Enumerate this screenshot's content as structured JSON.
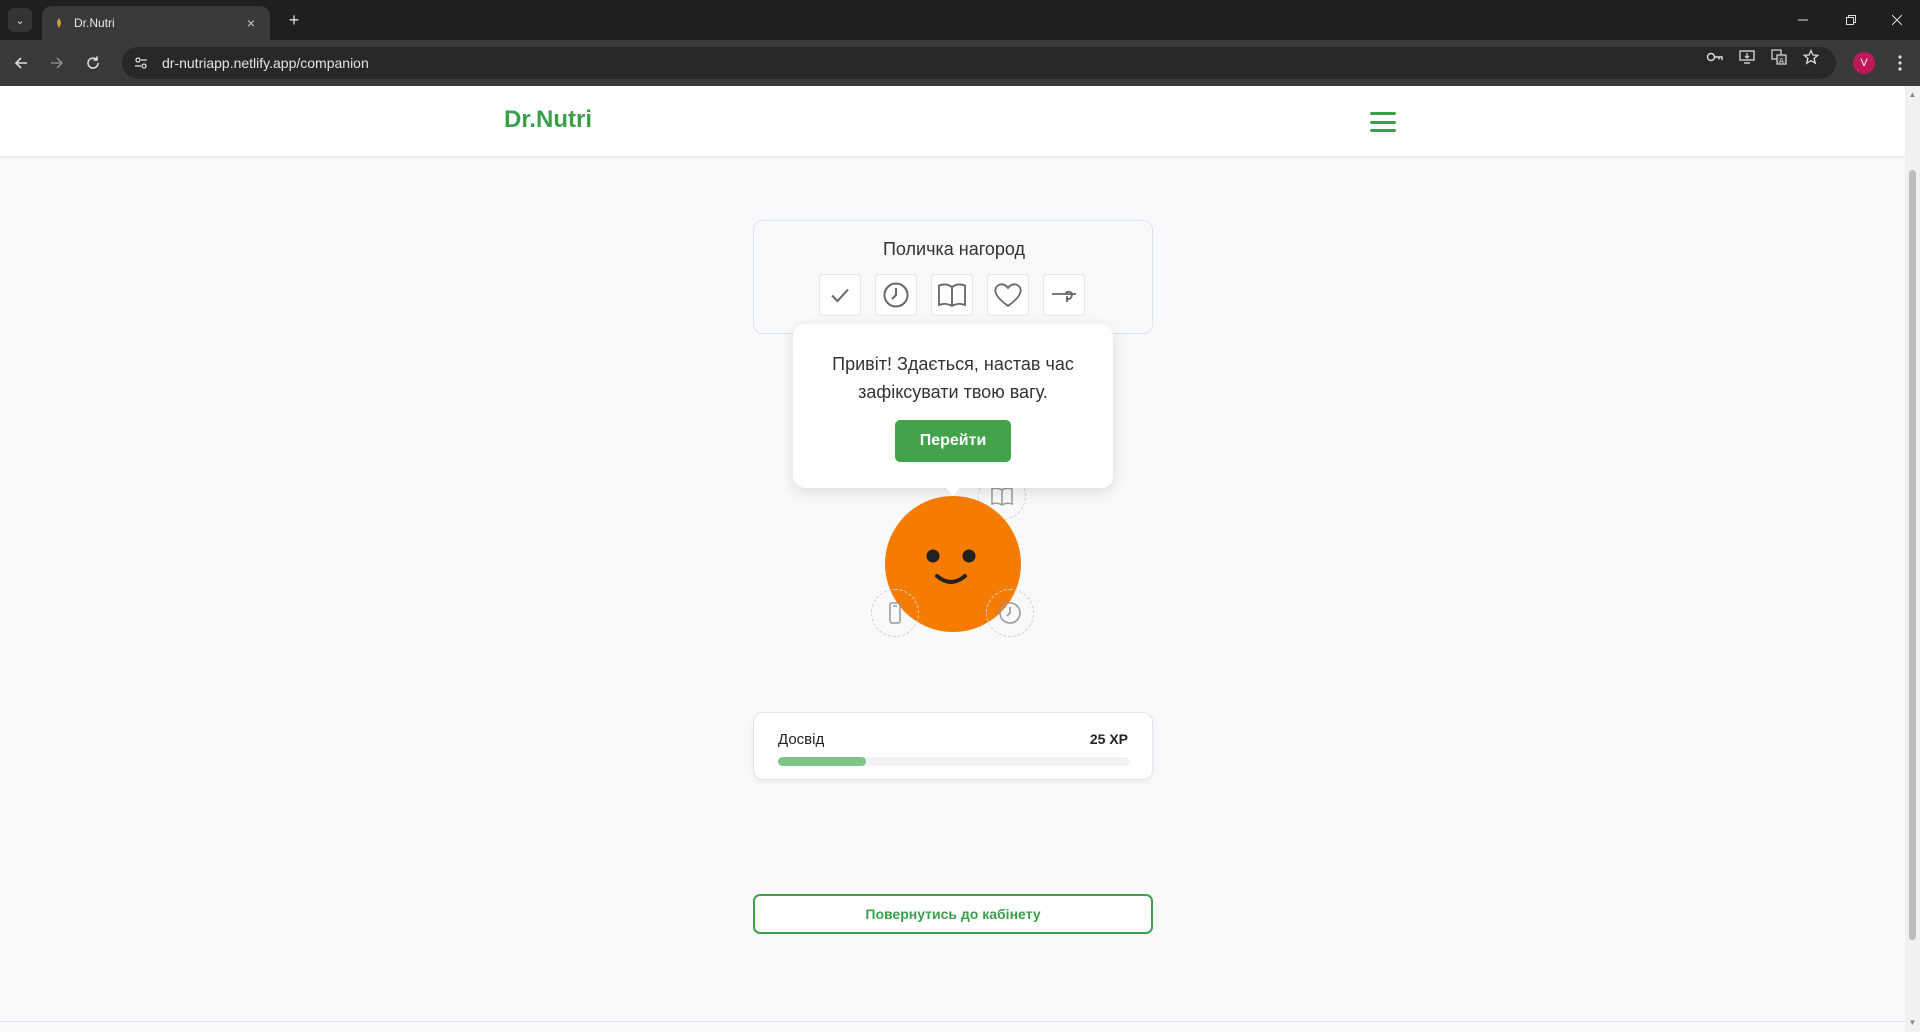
{
  "browser": {
    "tab_title": "Dr.Nutri",
    "tab_close": "×",
    "new_tab": "+",
    "url": "dr-nutriapp.netlify.app/companion",
    "profile_initial": "V"
  },
  "header": {
    "brand": "Dr.Nutri",
    "brand_color": "#3aa14a"
  },
  "shelf": {
    "title": "Поличка нагород",
    "badges": [
      {
        "icon": "checkmark-icon"
      },
      {
        "icon": "clock-icon"
      },
      {
        "icon": "book-icon"
      },
      {
        "icon": "heart-icon"
      },
      {
        "icon": "scale-icon"
      }
    ]
  },
  "bubble": {
    "message": "Привіт! Здається, настав час зафіксувати твою вагу.",
    "button_label": "Перейти"
  },
  "companion": {
    "color": "#f57c00",
    "orbit_icons": [
      "book-icon",
      "phone-icon",
      "clock-icon"
    ]
  },
  "xp": {
    "label": "Досвід",
    "value_text": "25 XP",
    "progress_fraction": 0.25,
    "fill_color": "#7dc585"
  },
  "back_button": {
    "label": "Повернутись до кабінету"
  }
}
